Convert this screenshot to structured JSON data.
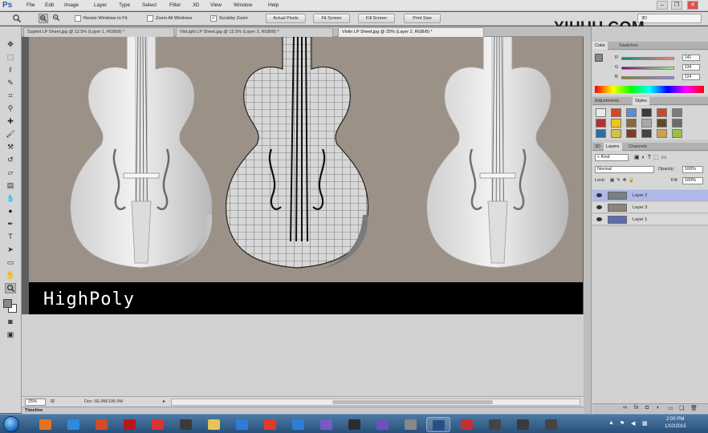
{
  "app": {
    "logo": "Ps",
    "menu": [
      "File",
      "Edit",
      "Image",
      "Layer",
      "Type",
      "Select",
      "Filter",
      "3D",
      "View",
      "Window",
      "Help"
    ],
    "window_controls": [
      "–",
      "❐",
      "✕"
    ]
  },
  "options_bar": {
    "resize_windows_label": "Resize Windows to Fit",
    "zoom_all_windows_label": "Zoom All Windows",
    "scrubby_zoom_label": "Scrubby Zoom",
    "scrubby_zoom_checked": true,
    "buttons": [
      "Actual Pixels",
      "Fit Screen",
      "Fill Screen",
      "Print Size"
    ],
    "workspace": "3D"
  },
  "watermark": "YIHUU.COM",
  "tabs": [
    {
      "label": "Supmit LP Sheet.jpg @ 12.5% (Layer 1, RGB/8) *",
      "active": false
    },
    {
      "label": "VioLight LP Sheet.jpg @ 12.5% (Layer 2, RGB/8) *",
      "active": false
    },
    {
      "label": "Violin LP Sheet.jpg @ 25% (Layer 2, RGB/8) *",
      "active": true
    }
  ],
  "canvas": {
    "caption": "HighPoly"
  },
  "status": {
    "zoom": "25%",
    "doc_info": "Doc: 66.9M/196.5M"
  },
  "timeline_label": "Timeline",
  "color_panel": {
    "tabs": [
      "Color",
      "Swatches"
    ],
    "sliders": [
      {
        "label": "R",
        "value": "141"
      },
      {
        "label": "G",
        "value": "134"
      },
      {
        "label": "B",
        "value": "124"
      }
    ]
  },
  "styles_panel": {
    "tabs": [
      "Adjustments",
      "Styles"
    ],
    "swatch_colors": [
      "#e9e9e9",
      "#d8471e",
      "#5b8fd1",
      "#3a3a3a",
      "#c94a2a",
      "#7c7c7c",
      "#b52f2f",
      "#f0c419",
      "#8a6b3c",
      "#a8a8a8",
      "#5e4a2e",
      "#6b6b6b",
      "#2f6e9e",
      "#d4c243",
      "#7a3e28",
      "#444444",
      "#c9a24a",
      "#9bbf48"
    ]
  },
  "layers_panel": {
    "tabs": [
      "3D",
      "Layers",
      "Channels"
    ],
    "kind_label": "Kind",
    "blend_mode": "Normal",
    "opacity_label": "Opacity:",
    "opacity_value": "100%",
    "lock_label": "Lock:",
    "fill_label": "Fill:",
    "fill_value": "100%",
    "layers": [
      {
        "name": "Layer 2",
        "selected": true,
        "thumb": "#7a7f8c"
      },
      {
        "name": "Layer 3",
        "selected": false,
        "thumb": "#8c857c"
      },
      {
        "name": "Layer 1",
        "selected": false,
        "thumb": "#5b6fae"
      }
    ],
    "footer_icons": [
      "∞",
      "fx",
      "◘",
      "◐",
      "▭",
      "❏",
      "🗑"
    ]
  },
  "taskbar": {
    "apps": [
      {
        "name": "firefox-icon",
        "color": "#e8711c",
        "running": false
      },
      {
        "name": "ie-icon",
        "color": "#2b8be0",
        "running": false
      },
      {
        "name": "games-icon",
        "color": "#d44a2a",
        "running": false
      },
      {
        "name": "filezilla-icon",
        "color": "#b8161c",
        "running": false
      },
      {
        "name": "paint-icon",
        "color": "#d93434",
        "running": false
      },
      {
        "name": "obs-icon",
        "color": "#3a3a3a",
        "running": false
      },
      {
        "name": "folder-icon",
        "color": "#e7c35a",
        "running": false
      },
      {
        "name": "media-player-icon",
        "color": "#2f7bd8",
        "running": false
      },
      {
        "name": "bandicam-icon",
        "color": "#e03a2a",
        "running": false
      },
      {
        "name": "dropbox-icon",
        "color": "#2b7fd9",
        "running": false
      },
      {
        "name": "app-icon",
        "color": "#7a58c9",
        "running": false
      },
      {
        "name": "skull-icon",
        "color": "#2d2d2d",
        "running": false
      },
      {
        "name": "monitor-icon",
        "color": "#6e4fbf",
        "running": false
      },
      {
        "name": "zbrush-icon",
        "color": "#888888",
        "running": false
      },
      {
        "name": "photoshop-icon",
        "color": "#2a4e86",
        "running": true
      },
      {
        "name": "unity-icon",
        "color": "#c23030",
        "running": false
      },
      {
        "name": "app2-icon",
        "color": "#444444",
        "running": false
      },
      {
        "name": "app3-icon",
        "color": "#3a3a3a",
        "running": false
      },
      {
        "name": "app4-icon",
        "color": "#444444",
        "running": false
      }
    ],
    "time": "2:00 PM",
    "date": "1/10/2015"
  }
}
